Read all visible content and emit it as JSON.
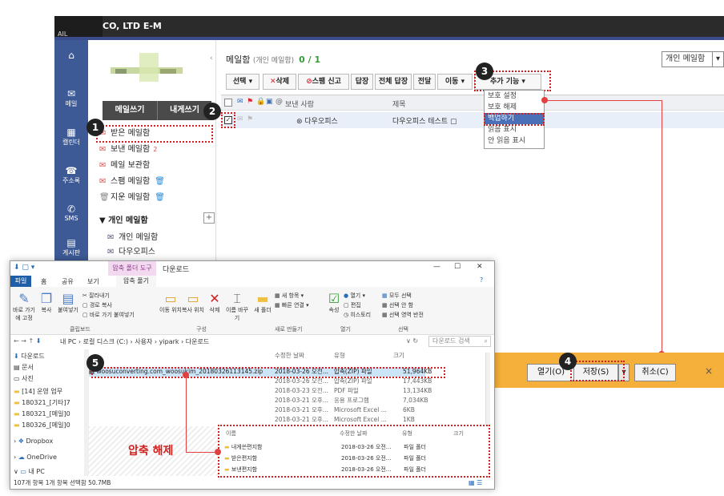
{
  "topbar": {
    "al": "AIL",
    "company": "CO, LTD E-M"
  },
  "leftnav": [
    {
      "label": "",
      "icon": "home-icon"
    },
    {
      "label": "메일",
      "icon": "mail-icon"
    },
    {
      "label": "캘린더",
      "icon": "calendar-icon"
    },
    {
      "label": "주소록",
      "icon": "contacts-icon"
    },
    {
      "label": "SMS",
      "icon": "sms-icon"
    },
    {
      "label": "게시판",
      "icon": "board-icon"
    }
  ],
  "mailside": {
    "write": "메일쓰기",
    "self": "내게쓰기",
    "folders": [
      {
        "label": "받은 메일함",
        "count": ""
      },
      {
        "label": "보낸 메일함",
        "count": "2"
      },
      {
        "label": "메일 보관함",
        "count": ""
      },
      {
        "label": "스팸 메일함",
        "count": ""
      },
      {
        "label": "지운 메일함",
        "count": ""
      }
    ],
    "personal_title": "개인 메일함",
    "personal": [
      "개인 메일함",
      "다우오피스"
    ]
  },
  "main": {
    "title": "메일함",
    "subtitle": "(개인 메일함)",
    "count": "0 / 1",
    "view": "개인 메일함",
    "toolbar": [
      "선택",
      "삭제",
      "스팸 신고",
      "답장",
      "전체 답장",
      "전달",
      "이동",
      "추가 기능"
    ],
    "list_header": {
      "from": "보낸 사람",
      "subject": "제목"
    },
    "row": {
      "from": "다우오피스",
      "subject": "다우오피스 테스트"
    }
  },
  "dropdown": [
    "보호 설정",
    "보호 해제",
    "백업하기",
    "읽음 표시",
    "안 읽음 표시"
  ],
  "callouts": [
    "1",
    "2",
    "3",
    "4",
    "5"
  ],
  "savebar": {
    "open": "열기(O)",
    "save": "저장(S)",
    "cancel": "취소(C)",
    "close": "×"
  },
  "explorer": {
    "ctx_tab": "압축 폴더 도구",
    "title": "다운로드",
    "tabs": [
      "파일",
      "홈",
      "공유",
      "보기",
      "압축 풀기"
    ],
    "ribbon": {
      "pin": "바로 가기에 고정",
      "copy": "복사",
      "paste": "붙여넣기",
      "cut": "잘라내기",
      "copypath": "경로 복사",
      "pasteshortcut": "바로 가기 붙여넣기",
      "moveto": "이동 위치",
      "copyto": "복사 위치",
      "delete": "삭제",
      "rename": "이름 바꾸기",
      "newfolder": "새 폴더",
      "newitem": "새 항목",
      "easyaccess": "빠른 연결",
      "props": "속성",
      "open": "열기",
      "edit": "편집",
      "history": "히스토리",
      "selectall": "모두 선택",
      "selectnone": "선택 안 함",
      "invert": "선택 영역 반전",
      "grp_clip": "클립보드",
      "grp_org": "구성",
      "grp_new": "새로 만들기",
      "grp_open": "열기",
      "grp_sel": "선택"
    },
    "address": "내 PC › 로컬 디스크 (C:) › 사용자 › yipark › 다운로드",
    "search": "다운로드 검색",
    "col_date": "수정한 날짜",
    "col_type": "유형",
    "col_size": "크기",
    "nav": [
      "다운로드",
      "문서",
      "사진",
      "[14] 운영 업무",
      "180321_[기타]7",
      "180321_[메일]0",
      "180326_[메일]0",
      "Dropbox",
      "OneDrive",
      "내 PC"
    ],
    "files": [
      {
        "name": "woosuconverting.com_woosukim_20180326113145.zip",
        "date": "2018-03-26 오전...",
        "type": "압축(ZIP) 파일",
        "size": "51,964KB"
      },
      {
        "name": "",
        "date": "2018-03-26 오전...",
        "type": "압축(ZIP) 파일",
        "size": "17,443KB"
      },
      {
        "name": "",
        "date": "2018-03-23 오전...",
        "type": "PDF 파일",
        "size": "13,134KB"
      },
      {
        "name": "",
        "date": "2018-03-21 오후...",
        "type": "응용 프로그램",
        "size": "7,034KB"
      },
      {
        "name": "",
        "date": "2018-03-21 오후...",
        "type": "Microsoft Excel ...",
        "size": "6KB"
      },
      {
        "name": "",
        "date": "2018-03-21 오후...",
        "type": "Microsoft Excel ...",
        "size": "1KB"
      }
    ],
    "status": "107개 항목    1개 항목 선택함 50.7MB"
  },
  "zipinner": {
    "col_name": "이름",
    "col_date": "수정한 날짜",
    "col_type": "유형",
    "col_size": "크기",
    "rows": [
      {
        "name": "내게쓴편지함",
        "date": "2018-03-26 오전...",
        "type": "파일 폴더"
      },
      {
        "name": "받은편지함",
        "date": "2018-03-26 오전...",
        "type": "파일 폴더"
      },
      {
        "name": "보낸편지함",
        "date": "2018-03-26 오전...",
        "type": "파일 폴더"
      }
    ]
  },
  "label5": "압축 해제"
}
